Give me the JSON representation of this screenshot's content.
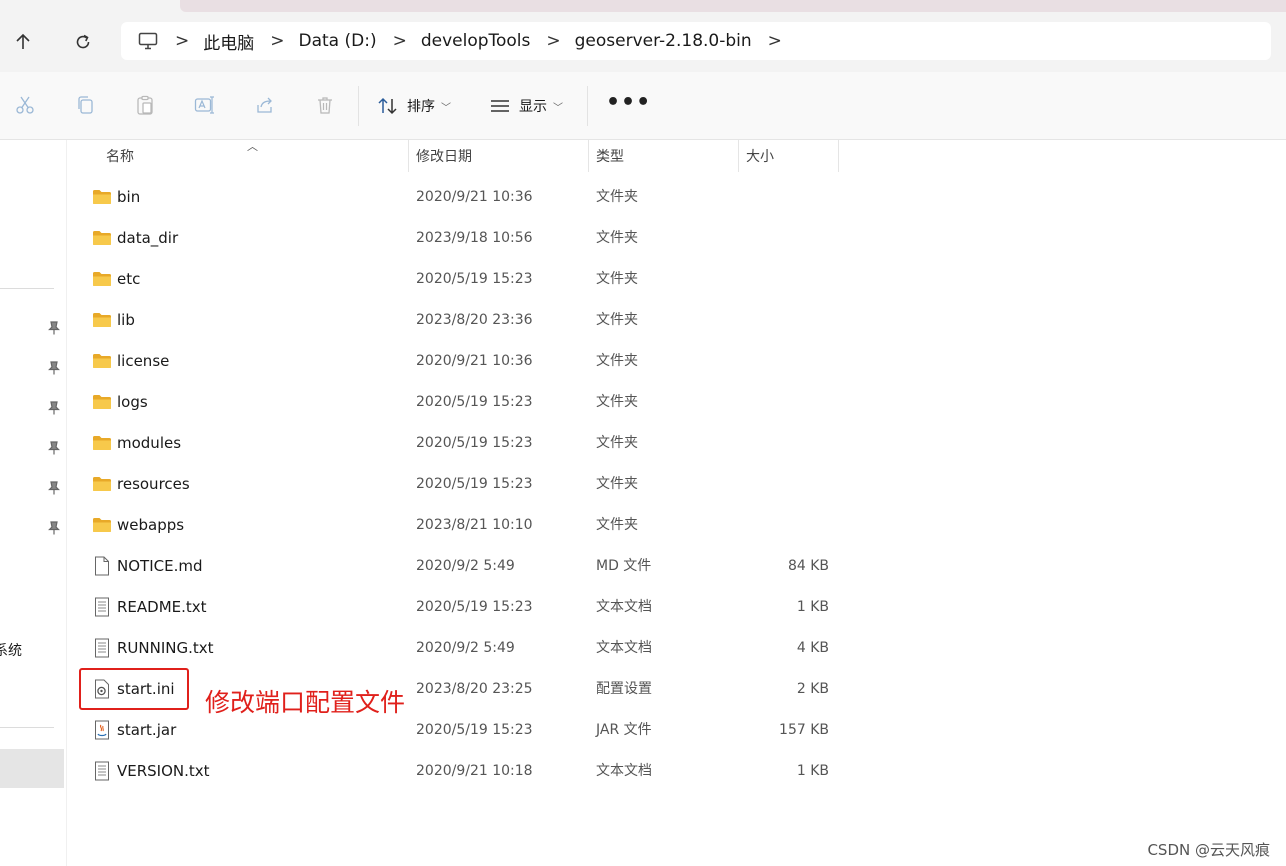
{
  "address_bar": {
    "crumbs": [
      "此电脑",
      "Data (D:)",
      "developTools",
      "geoserver-2.18.0-bin"
    ],
    "separator": ">"
  },
  "toolbar": {
    "icons": [
      "cut-icon",
      "copy-icon",
      "paste-icon",
      "rename-icon",
      "share-icon",
      "delete-icon"
    ],
    "sort_label": "排序",
    "view_label": "显示",
    "more_label": "•••"
  },
  "sidebar": {
    "partial_label": "系统"
  },
  "columns": {
    "name": "名称",
    "date": "修改日期",
    "type": "类型",
    "size": "大小"
  },
  "files": [
    {
      "name": "bin",
      "date": "2020/9/21 10:36",
      "type": "文件夹",
      "size": "",
      "icon": "folder-icon"
    },
    {
      "name": "data_dir",
      "date": "2023/9/18 10:56",
      "type": "文件夹",
      "size": "",
      "icon": "folder-icon"
    },
    {
      "name": "etc",
      "date": "2020/5/19 15:23",
      "type": "文件夹",
      "size": "",
      "icon": "folder-icon"
    },
    {
      "name": "lib",
      "date": "2023/8/20 23:36",
      "type": "文件夹",
      "size": "",
      "icon": "folder-icon"
    },
    {
      "name": "license",
      "date": "2020/9/21 10:36",
      "type": "文件夹",
      "size": "",
      "icon": "folder-icon"
    },
    {
      "name": "logs",
      "date": "2020/5/19 15:23",
      "type": "文件夹",
      "size": "",
      "icon": "folder-icon"
    },
    {
      "name": "modules",
      "date": "2020/5/19 15:23",
      "type": "文件夹",
      "size": "",
      "icon": "folder-icon"
    },
    {
      "name": "resources",
      "date": "2020/5/19 15:23",
      "type": "文件夹",
      "size": "",
      "icon": "folder-icon"
    },
    {
      "name": "webapps",
      "date": "2023/8/21 10:10",
      "type": "文件夹",
      "size": "",
      "icon": "folder-icon"
    },
    {
      "name": "NOTICE.md",
      "date": "2020/9/2 5:49",
      "type": "MD 文件",
      "size": "84 KB",
      "icon": "blank-file-icon"
    },
    {
      "name": "README.txt",
      "date": "2020/5/19 15:23",
      "type": "文本文档",
      "size": "1 KB",
      "icon": "text-file-icon"
    },
    {
      "name": "RUNNING.txt",
      "date": "2020/9/2 5:49",
      "type": "文本文档",
      "size": "4 KB",
      "icon": "text-file-icon"
    },
    {
      "name": "start.ini",
      "date": "2023/8/20 23:25",
      "type": "配置设置",
      "size": "2 KB",
      "icon": "config-file-icon"
    },
    {
      "name": "start.jar",
      "date": "2020/5/19 15:23",
      "type": "JAR 文件",
      "size": "157 KB",
      "icon": "jar-file-icon"
    },
    {
      "name": "VERSION.txt",
      "date": "2020/9/21 10:18",
      "type": "文本文档",
      "size": "1 KB",
      "icon": "text-file-icon"
    }
  ],
  "annotation": {
    "text": "修改端口配置文件",
    "color": "#e0201b"
  },
  "watermark": "CSDN @云天风痕",
  "colors": {
    "folder": "#f5c542",
    "accent_highlight": "#e0201b"
  }
}
